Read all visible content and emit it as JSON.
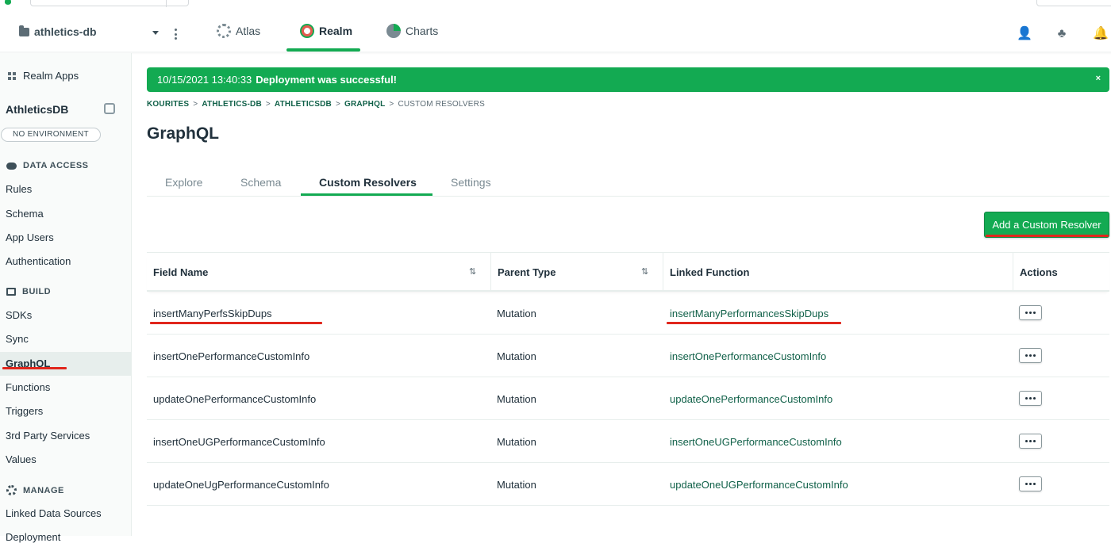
{
  "nav": {
    "project": "athletics-db",
    "tabs": [
      {
        "label": "Atlas"
      },
      {
        "label": "Realm"
      },
      {
        "label": "Charts"
      }
    ]
  },
  "sidebar": {
    "apps_label": "Realm Apps",
    "app_name": "AthleticsDB",
    "environment": "NO ENVIRONMENT",
    "sections": [
      {
        "label": "DATA ACCESS",
        "items": [
          "Rules",
          "Schema",
          "App Users",
          "Authentication"
        ]
      },
      {
        "label": "BUILD",
        "items": [
          "SDKs",
          "Sync",
          "GraphQL",
          "Functions",
          "Triggers",
          "3rd Party Services",
          "Values"
        ]
      },
      {
        "label": "MANAGE",
        "items": [
          "Linked Data Sources",
          "Deployment"
        ]
      }
    ],
    "active_item": "GraphQL"
  },
  "banner": {
    "timestamp": "10/15/2021 13:40:33",
    "message": "Deployment was successful!",
    "close": "×"
  },
  "breadcrumb": {
    "items": [
      "KOURITES",
      "ATHLETICS-DB",
      "ATHLETICSDB",
      "GRAPHQL"
    ],
    "separator": ">",
    "current": "CUSTOM RESOLVERS"
  },
  "page_title": "GraphQL",
  "tabs": [
    {
      "label": "Explore"
    },
    {
      "label": "Schema"
    },
    {
      "label": "Custom Resolvers"
    },
    {
      "label": "Settings"
    }
  ],
  "active_tab": "Custom Resolvers",
  "add_button_label": "Add a Custom Resolver",
  "table": {
    "columns": [
      "Field Name",
      "Parent Type",
      "Linked Function",
      "Actions"
    ],
    "rows": [
      {
        "field": "insertManyPerfsSkipDups",
        "parent": "Mutation",
        "function": "insertManyPerformancesSkipDups"
      },
      {
        "field": "insertOnePerformanceCustomInfo",
        "parent": "Mutation",
        "function": "insertOnePerformanceCustomInfo"
      },
      {
        "field": "updateOnePerformanceCustomInfo",
        "parent": "Mutation",
        "function": "updateOnePerformanceCustomInfo"
      },
      {
        "field": "insertOneUGPerformanceCustomInfo",
        "parent": "Mutation",
        "function": "insertOneUGPerformanceCustomInfo"
      },
      {
        "field": "updateOneUgPerformanceCustomInfo",
        "parent": "Mutation",
        "function": "updateOneUGPerformanceCustomInfo"
      }
    ]
  },
  "colors": {
    "accent": "#13aa52",
    "link": "#116149",
    "annotation": "#e0261c"
  }
}
